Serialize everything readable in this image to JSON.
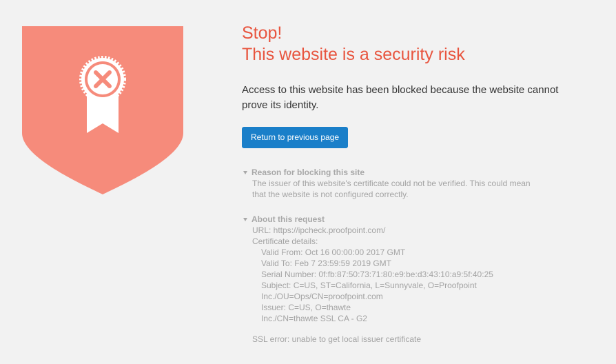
{
  "colors": {
    "background": "#f2f2f2",
    "shield": "#f68b7b",
    "title": "#e8553f",
    "button": "#1a7fc9",
    "details_text": "#a3a3a3"
  },
  "icons": {
    "shield": "shield-icon",
    "badge": "badge-x-icon",
    "ribbon": "ribbon-icon"
  },
  "heading": {
    "stop": "Stop!",
    "title": "This website is a security risk"
  },
  "message": "Access to this website has been blocked because the website cannot prove its identity.",
  "return_button": "Return to previous page",
  "reason": {
    "header": "Reason for blocking this site",
    "text": "The issuer of this website's certificate could not be verified. This could mean that the website is not configured correctly."
  },
  "request": {
    "header": "About this request",
    "url_line": "URL: https://ipcheck.proofpoint.com/",
    "cert_label": "Certificate details:",
    "valid_from": "Valid From: Oct 16 00:00:00 2017 GMT",
    "valid_to": "Valid To: Feb 7 23:59:59 2019 GMT",
    "serial": "Serial Number: 0f:fb:87:50:73:71:80:e9:be:d3:43:10:a9:5f:40:25",
    "subject_1": "Subject: C=US, ST=California, L=Sunnyvale, O=Proofpoint",
    "subject_2": "Inc./OU=Ops/CN=proofpoint.com",
    "issuer_1": "Issuer: C=US, O=thawte",
    "issuer_2": "Inc./CN=thawte SSL CA - G2",
    "ssl_error": "SSL error: unable to get local issuer certificate"
  }
}
